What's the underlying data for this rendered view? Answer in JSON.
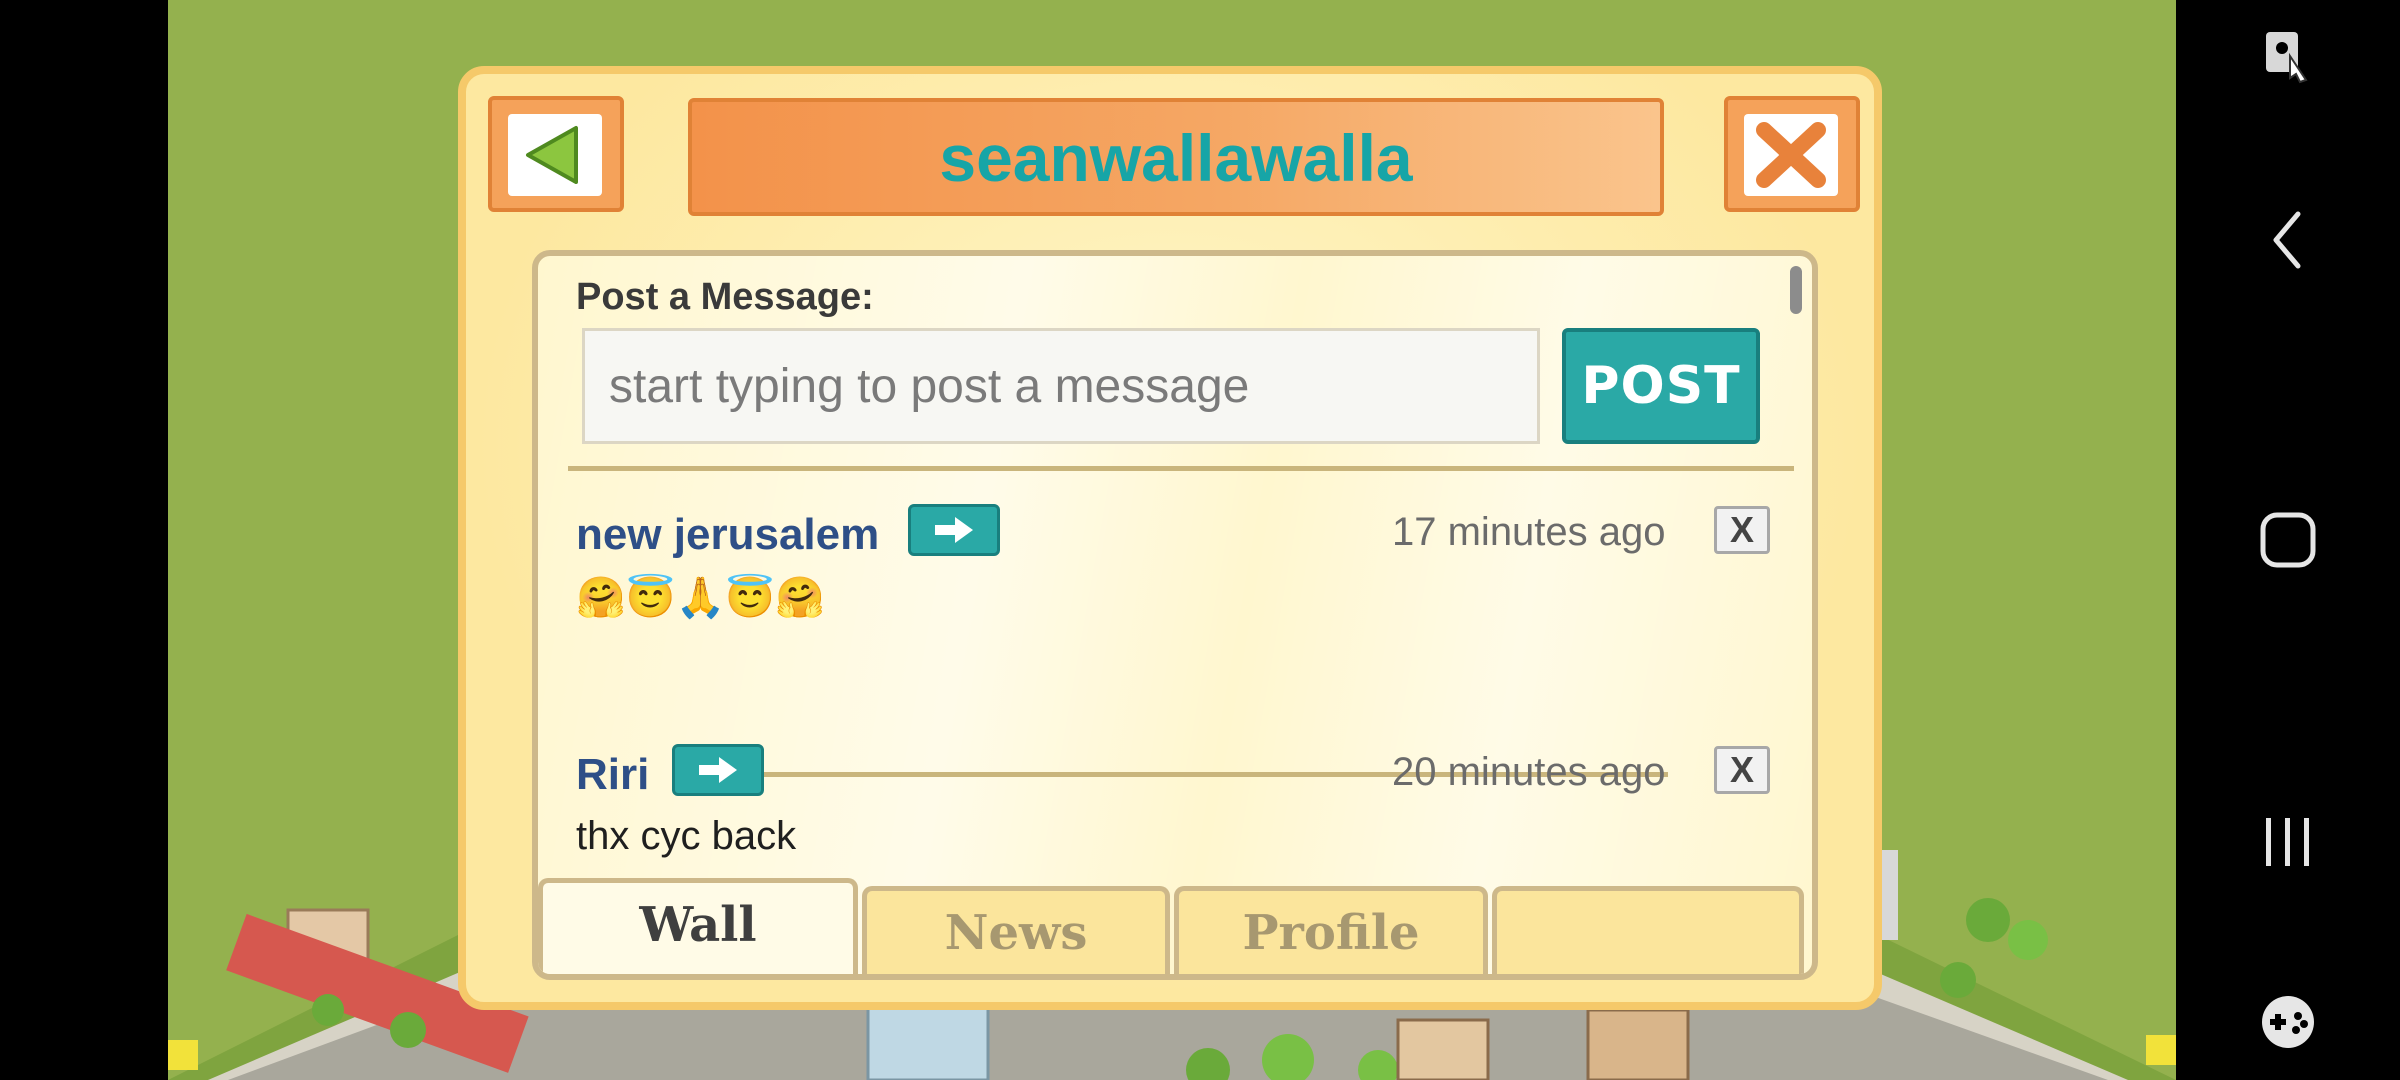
{
  "title": "seanwallawalla",
  "composer": {
    "label": "Post a Message:",
    "placeholder": "start typing to post a message",
    "post_label": "POST"
  },
  "posts": [
    {
      "author": "new jerusalem",
      "time": "17 minutes ago",
      "message": "🤗😇🙏😇🤗",
      "delete_label": "X"
    },
    {
      "author": "Riri",
      "time": "20 minutes ago",
      "message": "thx cyc back",
      "delete_label": "X"
    }
  ],
  "tabs": [
    {
      "label": "Wall",
      "active": true
    },
    {
      "label": "News",
      "active": false
    },
    {
      "label": "Profile",
      "active": false
    },
    {
      "label": "",
      "active": false
    }
  ],
  "colors": {
    "title": "#17a5a7",
    "accent_teal": "#2aa9a6",
    "orange": "#f39a52",
    "background_green": "#94b14e"
  },
  "icons": {
    "back": "back-arrow-icon",
    "close": "close-x-icon",
    "goto_profile": "right-arrow-icon",
    "system_nav": [
      "screen-assist-icon",
      "nav-back-icon",
      "nav-home-icon",
      "nav-recents-icon",
      "game-tools-icon"
    ]
  }
}
